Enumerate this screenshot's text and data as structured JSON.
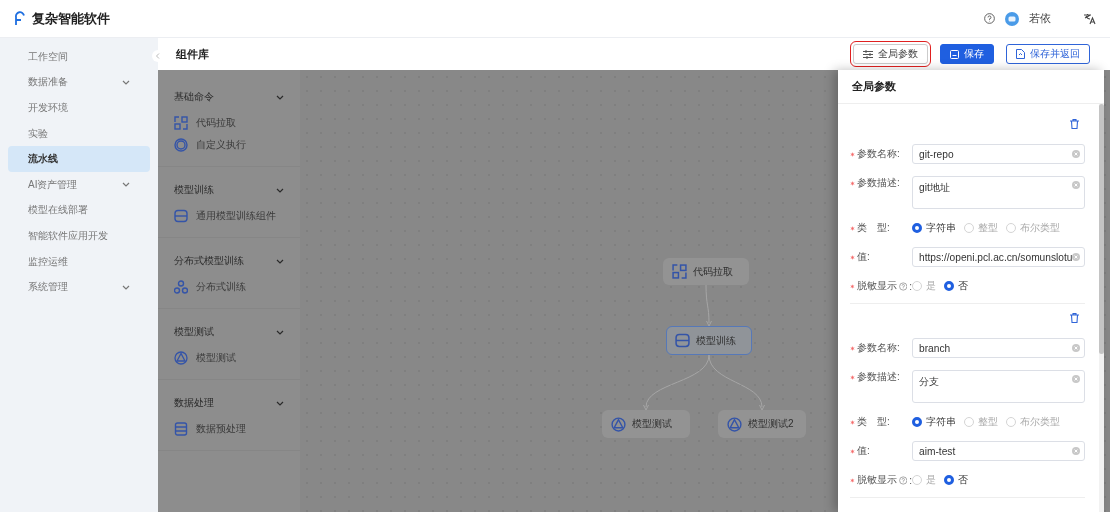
{
  "app": {
    "title": "复杂智能软件"
  },
  "header": {
    "user": "若依"
  },
  "sidebar": {
    "items": [
      {
        "label": "工作空间",
        "selected": false,
        "expandable": false
      },
      {
        "label": "数据准备",
        "selected": false,
        "expandable": true
      },
      {
        "label": "开发环境",
        "selected": false,
        "expandable": false
      },
      {
        "label": "实验",
        "selected": false,
        "expandable": false
      },
      {
        "label": "流水线",
        "selected": true,
        "expandable": false
      },
      {
        "label": "AI资产管理",
        "selected": false,
        "expandable": true
      },
      {
        "label": "模型在线部署",
        "selected": false,
        "expandable": false
      },
      {
        "label": "智能软件应用开发",
        "selected": false,
        "expandable": false
      },
      {
        "label": "监控运维",
        "selected": false,
        "expandable": false
      },
      {
        "label": "系统管理",
        "selected": false,
        "expandable": true
      }
    ]
  },
  "toolbar": {
    "title": "组件库",
    "buttons": [
      {
        "label": "全局参数",
        "kind": "params",
        "highlighted": true
      },
      {
        "label": "保存",
        "kind": "primary",
        "highlighted": false
      },
      {
        "label": "保存并返回",
        "kind": "outline",
        "highlighted": false
      }
    ]
  },
  "library": {
    "groups": [
      {
        "title": "基础命令",
        "items": [
          {
            "label": "代码拉取",
            "kind": "pull"
          },
          {
            "label": "自定义执行",
            "kind": "custom"
          }
        ]
      },
      {
        "title": "模型训练",
        "items": [
          {
            "label": "通用模型训练组件",
            "kind": "train"
          }
        ]
      },
      {
        "title": "分布式模型训练",
        "items": [
          {
            "label": "分布式训练",
            "kind": "distributed"
          }
        ]
      },
      {
        "title": "模型测试",
        "items": [
          {
            "label": "模型测试",
            "kind": "test"
          }
        ]
      },
      {
        "title": "数据处理",
        "items": [
          {
            "label": "数据预处理",
            "kind": "data"
          }
        ]
      }
    ]
  },
  "canvas": {
    "nodes": [
      {
        "label": "代码拉取",
        "kind": "pull",
        "selected": false,
        "children": [
          {
            "label": "模型训练",
            "kind": "train",
            "selected": true,
            "children": [
              {
                "label": "模型测试",
                "kind": "test",
                "selected": false
              },
              {
                "label": "模型测试2",
                "kind": "test",
                "selected": false
              }
            ]
          }
        ]
      }
    ]
  },
  "drawer": {
    "title": "全局参数",
    "params": [
      {
        "fields": [
          {
            "kind": "input",
            "label": "参数名称:",
            "value": "git-repo"
          },
          {
            "kind": "textarea",
            "label": "参数描述:",
            "value": "git地址"
          },
          {
            "kind": "radio",
            "label": "类　型:",
            "options": [
              {
                "label": "字符串",
                "selected": true
              },
              {
                "label": "整型",
                "selected": false
              },
              {
                "label": "布尔类型",
                "selected": false
              }
            ]
          },
          {
            "kind": "input",
            "label": "值:",
            "value": "https://openi.pcl.ac.cn/somunslotu"
          },
          {
            "kind": "radio",
            "label": "脱敏显示",
            "help": true,
            "suffix": ":",
            "options": [
              {
                "label": "是",
                "selected": false
              },
              {
                "label": "否",
                "selected": true
              }
            ]
          }
        ]
      },
      {
        "fields": [
          {
            "kind": "input",
            "label": "参数名称:",
            "value": "branch"
          },
          {
            "kind": "textarea",
            "label": "参数描述:",
            "value": "分支"
          },
          {
            "kind": "radio",
            "label": "类　型:",
            "options": [
              {
                "label": "字符串",
                "selected": true
              },
              {
                "label": "整型",
                "selected": false
              },
              {
                "label": "布尔类型",
                "selected": false
              }
            ]
          },
          {
            "kind": "input",
            "label": "值:",
            "value": "aim-test"
          },
          {
            "kind": "radio",
            "label": "脱敏显示",
            "help": true,
            "suffix": ":",
            "options": [
              {
                "label": "是",
                "selected": false
              },
              {
                "label": "否",
                "selected": true
              }
            ]
          }
        ]
      }
    ]
  }
}
